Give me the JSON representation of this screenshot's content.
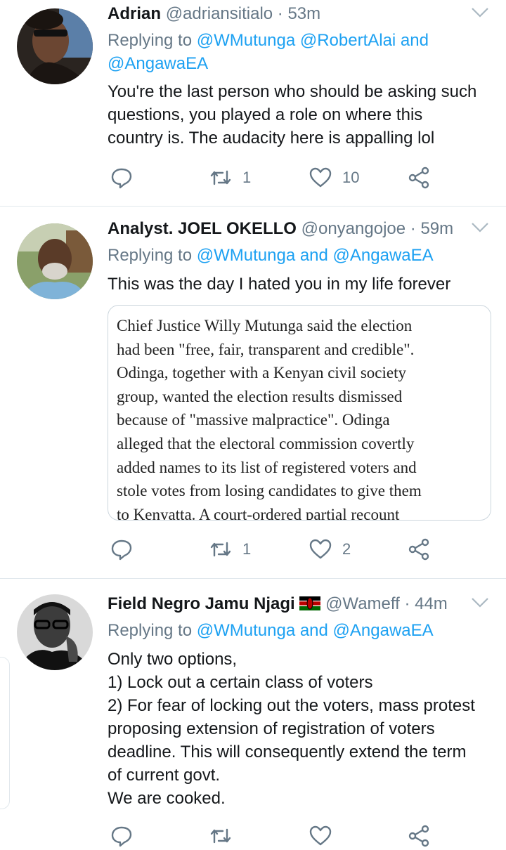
{
  "tweets": [
    {
      "name": "Adrian",
      "handle": "@adriansitialo",
      "time": "· 53m",
      "reply_prefix": "Replying to",
      "reply_line1": "@WMutunga @RobertAlai and",
      "reply_line2": "@AngawaEA",
      "body": [
        "You're the last person who should be asking such",
        "questions, you played a role on where this",
        "country is. The audacity here is appalling lol"
      ],
      "retweets": "1",
      "likes": "10"
    },
    {
      "name": "Analyst. JOEL OKELLO",
      "handle": "@onyangojoe",
      "time": "· 59m",
      "reply_prefix": "Replying to",
      "reply_line1": "@WMutunga and @AngawaEA",
      "body": [
        "This was the day I hated you in my life forever"
      ],
      "quote_lines": [
        "Chief Justice Willy Mutunga said the election",
        "had been \"free, fair, transparent and credible\".",
        "Odinga, together with a Kenyan civil society",
        "group, wanted the election results dismissed",
        "because of \"massive malpractice\". Odinga",
        "alleged that the electoral commission covertly",
        "added names to its list of registered voters and",
        "stole votes from losing candidates to give them",
        "to Kenyatta. A court-ordered partial recount"
      ],
      "retweets": "1",
      "likes": "2"
    },
    {
      "name": "Field Negro Jamu Njagi",
      "flag": "kenya-flag-emoji",
      "handle": "@Wameff",
      "time": "· 44m",
      "reply_prefix": "Replying to",
      "reply_line1": "@WMutunga and @AngawaEA",
      "body": [
        "Only two options,",
        "1) Lock out a certain class of voters",
        "2) For fear of locking out the voters, mass protest",
        "proposing extension of registration of voters",
        "deadline. This will consequently extend the term",
        "of current govt.",
        "We are cooked."
      ]
    }
  ],
  "colors": {
    "accent": "#1da1f2",
    "muted": "#657786",
    "text": "#14171a",
    "divider": "#e1e8ed"
  },
  "icons": [
    "reply-icon",
    "retweet-icon",
    "like-icon",
    "share-icon",
    "chevron-down-icon"
  ]
}
